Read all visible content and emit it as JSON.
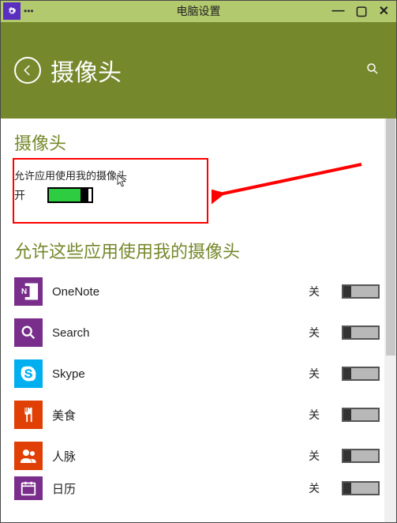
{
  "titlebar": {
    "title": "电脑设置",
    "dots": "•••",
    "minimize": "—",
    "maximize": "▢",
    "close": "✕"
  },
  "header": {
    "title": "摄像头"
  },
  "main": {
    "section_title": "摄像头",
    "allow_label": "允许应用使用我的摄像头",
    "allow_state": "开"
  },
  "sub": {
    "title": "允许这些应用使用我的摄像头"
  },
  "apps": [
    {
      "name": "OneNote",
      "state": "关"
    },
    {
      "name": "Search",
      "state": "关"
    },
    {
      "name": "Skype",
      "state": "关"
    },
    {
      "name": "美食",
      "state": "关"
    },
    {
      "name": "人脉",
      "state": "关"
    },
    {
      "name": "日历",
      "state": "关"
    }
  ],
  "icons": {
    "onenote_letter": "N"
  }
}
